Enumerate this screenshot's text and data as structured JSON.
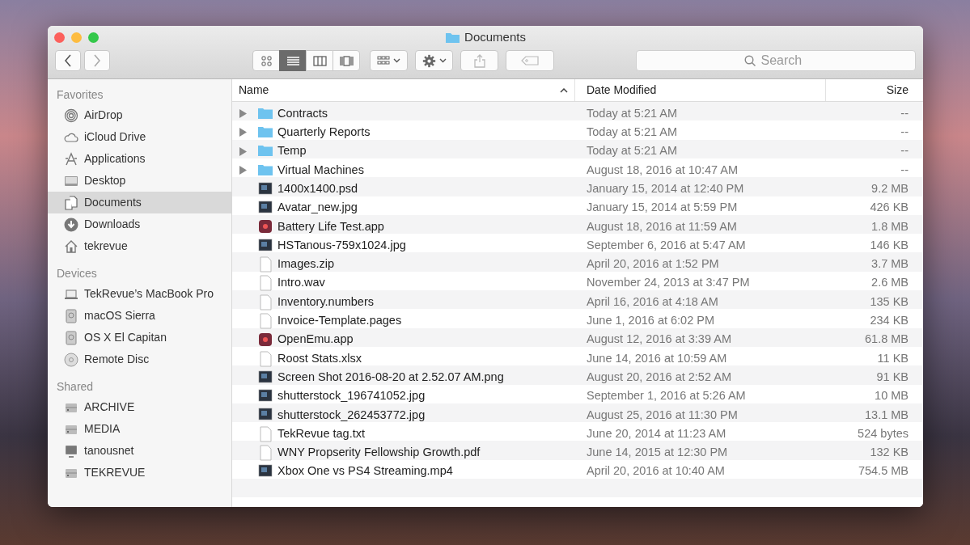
{
  "window": {
    "title": "Documents"
  },
  "toolbar": {
    "view_modes": [
      {
        "selected": false
      },
      {
        "selected": true
      },
      {
        "selected": false
      },
      {
        "selected": false
      }
    ],
    "search": {
      "placeholder": "Search"
    }
  },
  "sidebar": {
    "sections": [
      {
        "title": "Favorites",
        "items": [
          {
            "label": "AirDrop",
            "selected": false
          },
          {
            "label": "iCloud Drive",
            "selected": false
          },
          {
            "label": "Applications",
            "selected": false
          },
          {
            "label": "Desktop",
            "selected": false
          },
          {
            "label": "Documents",
            "selected": true
          },
          {
            "label": "Downloads",
            "selected": false
          },
          {
            "label": "tekrevue",
            "selected": false
          }
        ]
      },
      {
        "title": "Devices",
        "items": [
          {
            "label": "TekRevue’s MacBook Pro",
            "selected": false
          },
          {
            "label": "macOS Sierra",
            "selected": false
          },
          {
            "label": "OS X El Capitan",
            "selected": false
          },
          {
            "label": "Remote Disc",
            "selected": false
          }
        ]
      },
      {
        "title": "Shared",
        "items": [
          {
            "label": "ARCHIVE",
            "selected": false
          },
          {
            "label": "MEDIA",
            "selected": false
          },
          {
            "label": "tanousnet",
            "selected": false
          },
          {
            "label": "TEKREVUE",
            "selected": false
          }
        ]
      }
    ]
  },
  "table": {
    "columns": [
      {
        "label": "Name",
        "sorted": true
      },
      {
        "label": "Date Modified",
        "sorted": false
      },
      {
        "label": "Size",
        "sorted": false
      }
    ],
    "rows": [
      {
        "kind": "folder",
        "name": "Contracts",
        "date": "Today at 5:21 AM",
        "size": "--"
      },
      {
        "kind": "folder",
        "name": "Quarterly Reports",
        "date": "Today at 5:21 AM",
        "size": "--"
      },
      {
        "kind": "folder",
        "name": "Temp",
        "date": "Today at 5:21 AM",
        "size": "--"
      },
      {
        "kind": "folder",
        "name": "Virtual Machines",
        "date": "August 18, 2016 at 10:47 AM",
        "size": "--"
      },
      {
        "kind": "image",
        "name": "1400x1400.psd",
        "date": "January 15, 2014 at 12:40 PM",
        "size": "9.2 MB"
      },
      {
        "kind": "image",
        "name": "Avatar_new.jpg",
        "date": "January 15, 2014 at 5:59 PM",
        "size": "426 KB"
      },
      {
        "kind": "app",
        "name": "Battery Life Test.app",
        "date": "August 18, 2016 at 11:59 AM",
        "size": "1.8 MB"
      },
      {
        "kind": "image",
        "name": "HSTanous-759x1024.jpg",
        "date": "September 6, 2016 at 5:47 AM",
        "size": "146 KB"
      },
      {
        "kind": "file",
        "name": "Images.zip",
        "date": "April 20, 2016 at 1:52 PM",
        "size": "3.7 MB"
      },
      {
        "kind": "file",
        "name": "Intro.wav",
        "date": "November 24, 2013 at 3:47 PM",
        "size": "2.6 MB"
      },
      {
        "kind": "file",
        "name": "Inventory.numbers",
        "date": "April 16, 2016 at 4:18 AM",
        "size": "135 KB"
      },
      {
        "kind": "file",
        "name": "Invoice-Template.pages",
        "date": "June 1, 2016 at 6:02 PM",
        "size": "234 KB"
      },
      {
        "kind": "app",
        "name": "OpenEmu.app",
        "date": "August 12, 2016 at 3:39 AM",
        "size": "61.8 MB"
      },
      {
        "kind": "file",
        "name": "Roost Stats.xlsx",
        "date": "June 14, 2016 at 10:59 AM",
        "size": "11 KB"
      },
      {
        "kind": "image",
        "name": "Screen Shot 2016-08-20 at 2.52.07 AM.png",
        "date": "August 20, 2016 at 2:52 AM",
        "size": "91 KB"
      },
      {
        "kind": "image",
        "name": "shutterstock_196741052.jpg",
        "date": "September 1, 2016 at 5:26 AM",
        "size": "10 MB"
      },
      {
        "kind": "image",
        "name": "shutterstock_262453772.jpg",
        "date": "August 25, 2016 at 11:30 PM",
        "size": "13.1 MB"
      },
      {
        "kind": "file",
        "name": "TekRevue tag.txt",
        "date": "June 20, 2014 at 11:23 AM",
        "size": "524 bytes"
      },
      {
        "kind": "file",
        "name": "WNY Propserity Fellowship Growth.pdf",
        "date": "June 14, 2015 at 12:30 PM",
        "size": "132 KB"
      },
      {
        "kind": "image",
        "name": "Xbox One vs PS4 Streaming.mp4",
        "date": "April 20, 2016 at 10:40 AM",
        "size": "754.5 MB"
      }
    ]
  }
}
